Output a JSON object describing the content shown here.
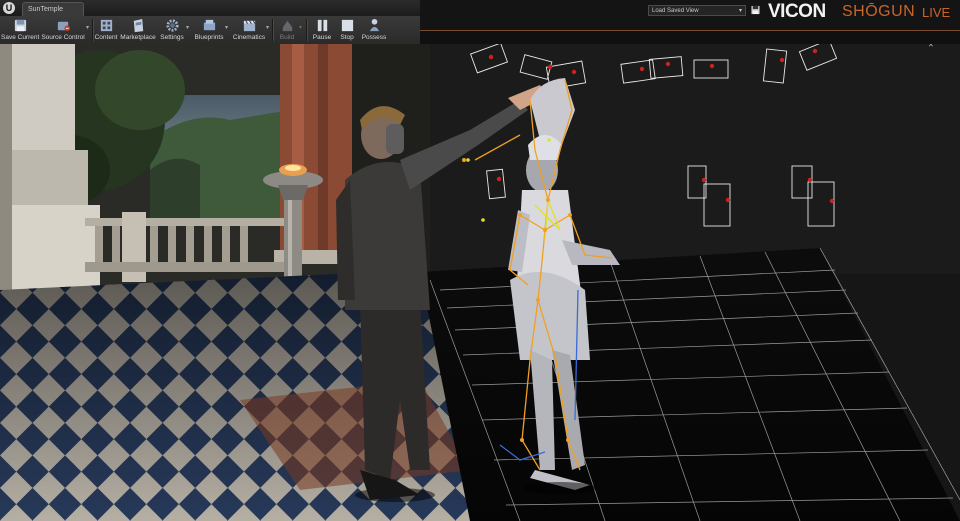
{
  "window": {
    "document_tab": "SunTemple"
  },
  "toolbar": {
    "buttons": [
      {
        "label": "Save Current",
        "icon": "save-icon"
      },
      {
        "label": "Source Control",
        "icon": "source-control-icon"
      },
      {
        "label": "Content",
        "icon": "content-browser-icon"
      },
      {
        "label": "Marketplace",
        "icon": "marketplace-icon"
      },
      {
        "label": "Settings",
        "icon": "gear-icon"
      },
      {
        "label": "Blueprints",
        "icon": "blueprint-icon"
      },
      {
        "label": "Cinematics",
        "icon": "clapperboard-icon"
      },
      {
        "label": "Build",
        "icon": "build-icon"
      },
      {
        "label": "Pause",
        "icon": "pause-icon"
      },
      {
        "label": "Stop",
        "icon": "stop-icon"
      },
      {
        "label": "Possess",
        "icon": "possess-icon"
      }
    ]
  },
  "header": {
    "view_dropdown": "Load Saved View",
    "logo": {
      "vicon": "VICON",
      "product": "SHŌGUN",
      "edition": "LIVE"
    },
    "accent_color": "#c8652c"
  },
  "viewport": {
    "panel_controls": "⊟ ⊡ ✕"
  }
}
